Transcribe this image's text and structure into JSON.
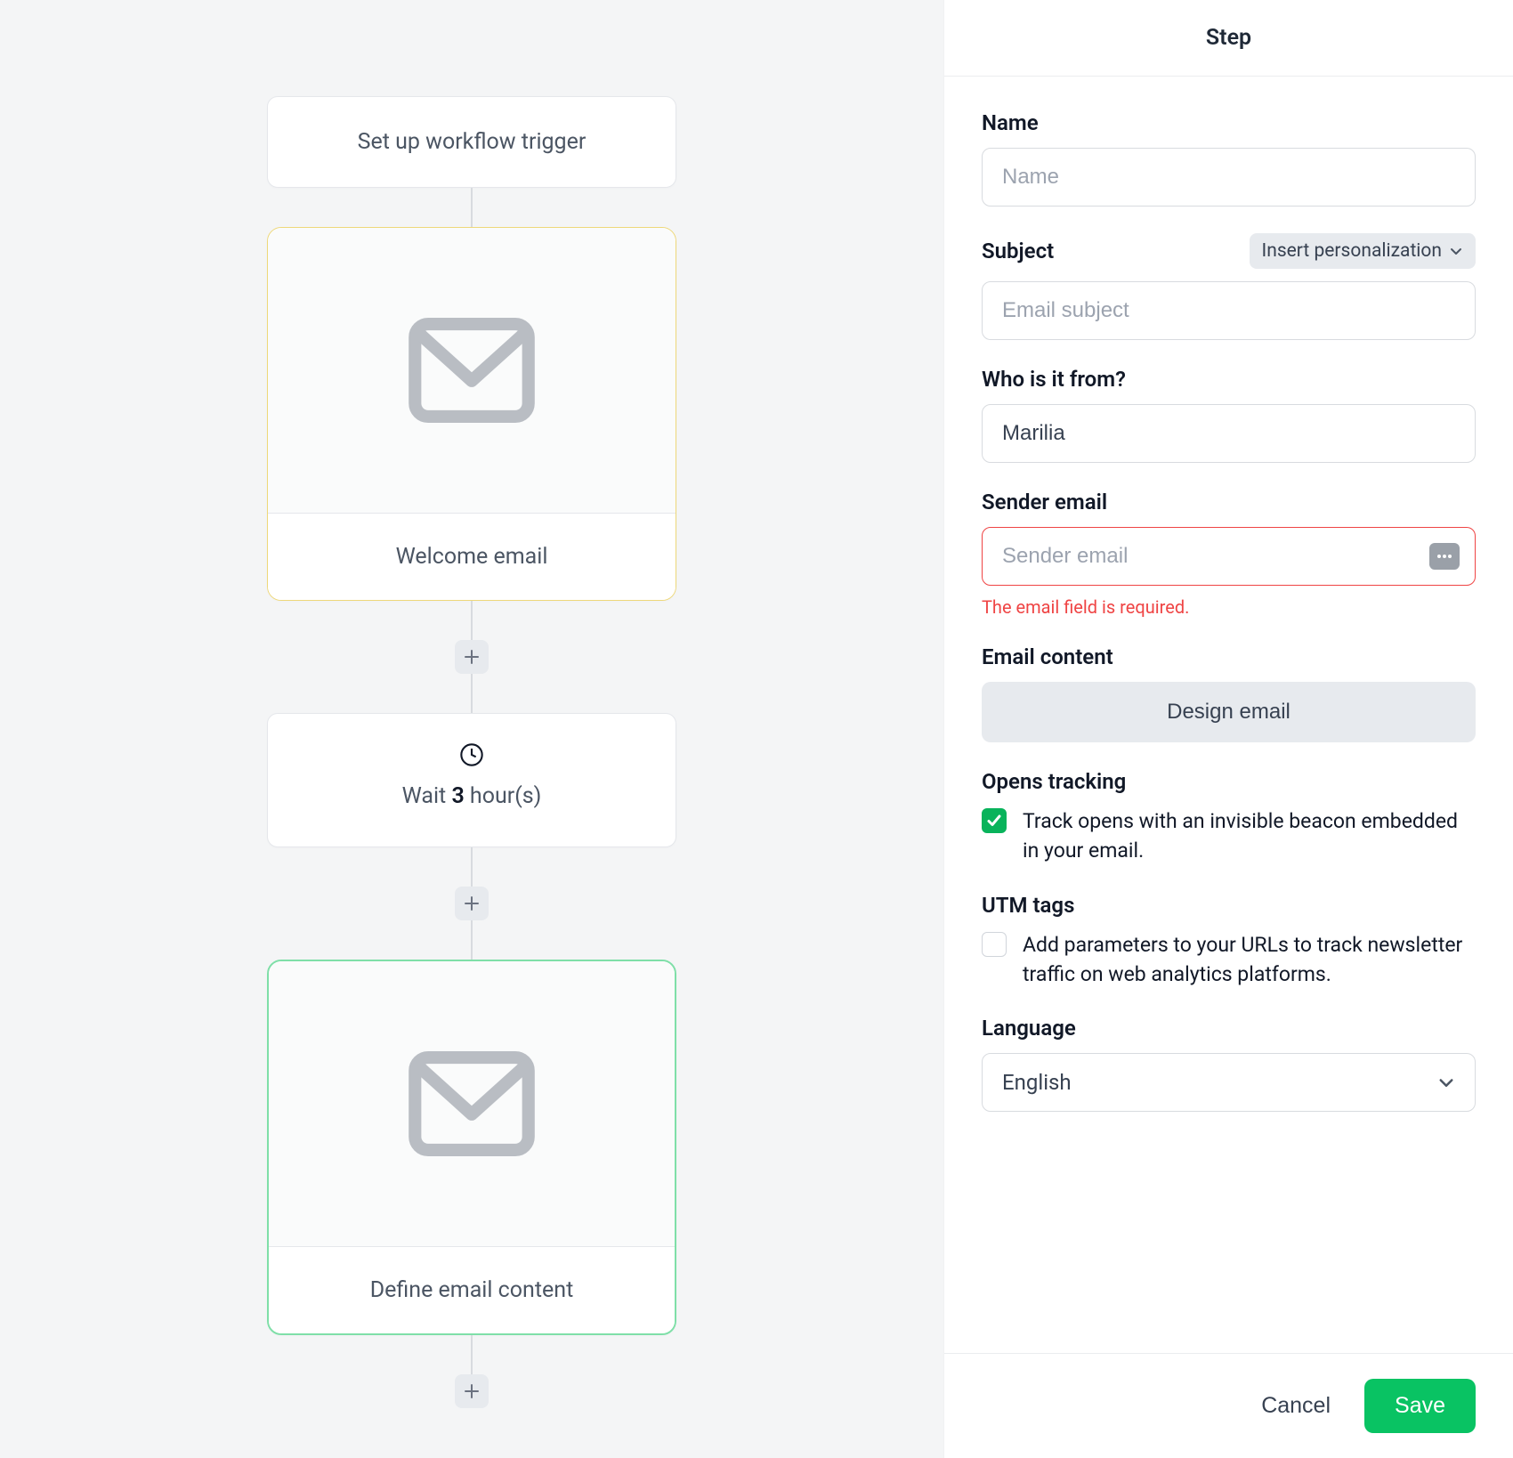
{
  "panel": {
    "title": "Step",
    "name_label": "Name",
    "name_placeholder": "Name",
    "subject_label": "Subject",
    "subject_placeholder": "Email subject",
    "personalization_chip": "Insert personalization",
    "from_label": "Who is it from?",
    "from_value": "Marilia",
    "sender_label": "Sender email",
    "sender_placeholder": "Sender email",
    "sender_error": "The email field is required.",
    "content_label": "Email content",
    "design_button": "Design email",
    "opens_label": "Opens tracking",
    "opens_desc": "Track opens with an invisible beacon embedded in your email.",
    "utm_label": "UTM tags",
    "utm_desc": "Add parameters to your URLs to track newsletter traffic on web analytics platforms.",
    "language_label": "Language",
    "language_value": "English",
    "cancel": "Cancel",
    "save": "Save"
  },
  "flow": {
    "trigger": "Set up workflow trigger",
    "email1": "Welcome email",
    "wait_prefix": "Wait ",
    "wait_value": "3",
    "wait_suffix": " hour(s)",
    "email2": "Define email content"
  }
}
